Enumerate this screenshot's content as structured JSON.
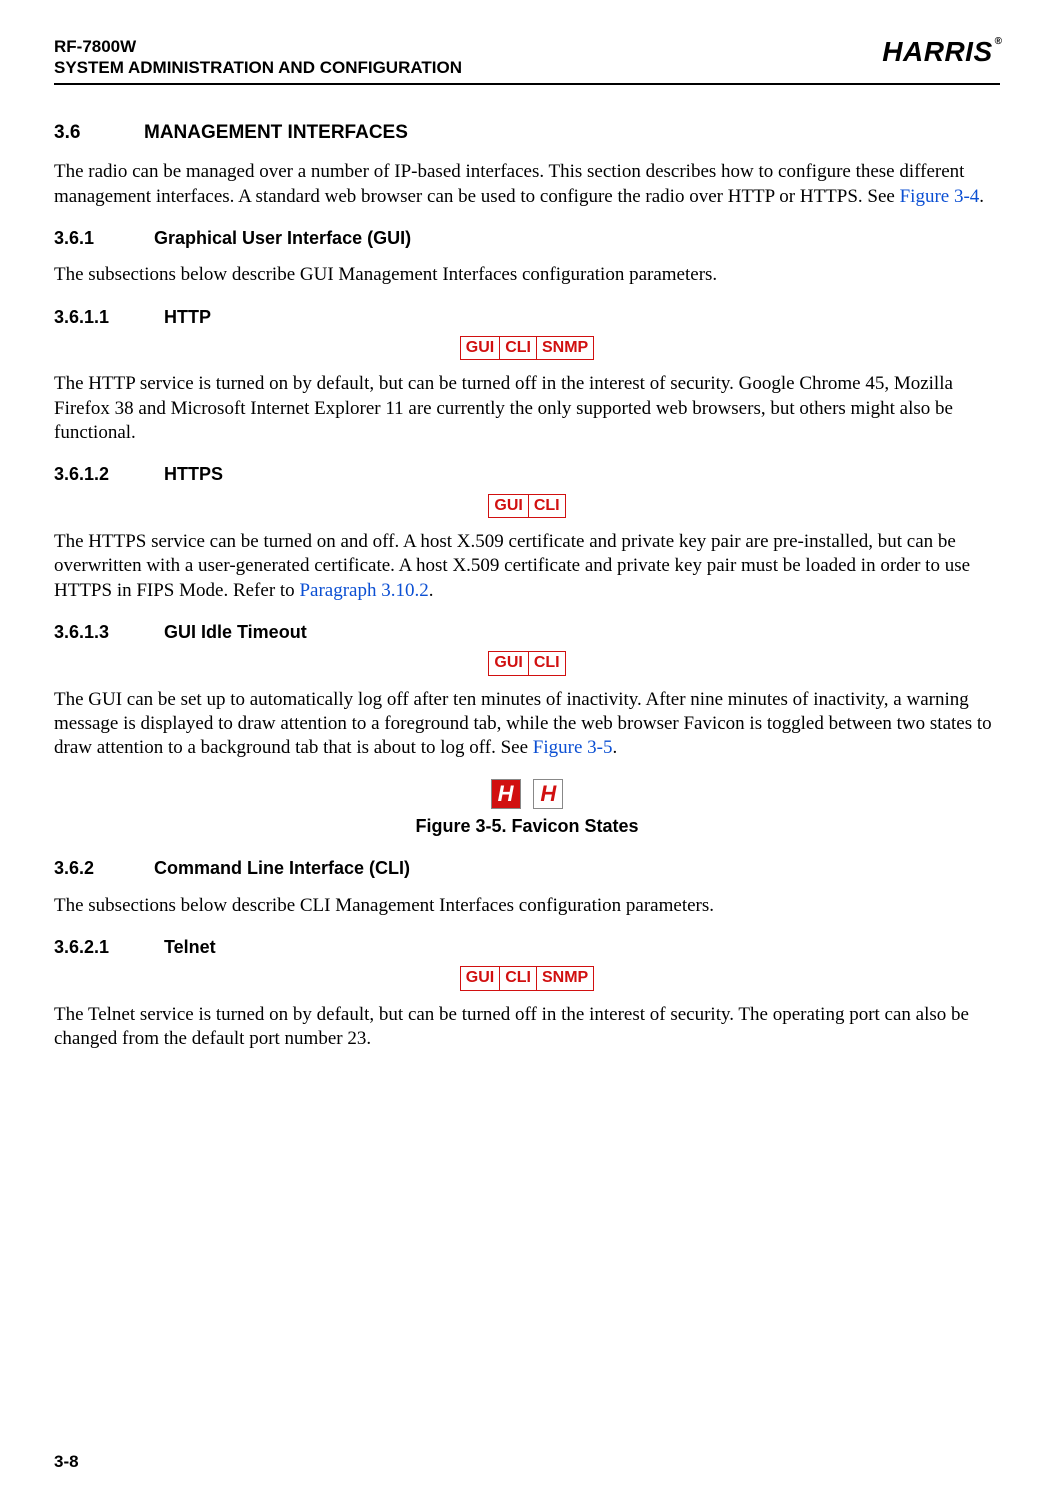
{
  "header": {
    "product": "RF-7800W",
    "subtitle": "SYSTEM ADMINISTRATION AND CONFIGURATION",
    "brand": "HARRIS",
    "reg": "®"
  },
  "page_number": "3-8",
  "sec_3_6": {
    "num": "3.6",
    "title": "MANAGEMENT INTERFACES",
    "para_pre": "The radio can be managed over a number of IP-based interfaces. This section describes how to configure these different management interfaces. A standard web browser can be used to configure the radio over HTTP or HTTPS. See ",
    "link": "Figure 3-4",
    "para_post": "."
  },
  "sec_3_6_1": {
    "num": "3.6.1",
    "title": "Graphical User Interface (GUI)",
    "para": "The subsections below describe GUI Management Interfaces configuration parameters."
  },
  "sec_3_6_1_1": {
    "num": "3.6.1.1",
    "title": "HTTP",
    "tags": {
      "gui": "GUI",
      "cli": "CLI",
      "snmp": "SNMP"
    },
    "para": "The HTTP service is turned on by default, but can be turned off in the interest of security. Google Chrome 45, Mozilla Firefox 38 and Microsoft Internet Explorer 11 are currently the only supported web browsers, but others might also be functional."
  },
  "sec_3_6_1_2": {
    "num": "3.6.1.2",
    "title": "HTTPS",
    "tags": {
      "gui": "GUI",
      "cli": "CLI"
    },
    "para_pre": "The HTTPS service can be turned on and off. A host X.509 certificate and private key pair are pre-installed, but can be overwritten with a user-generated certificate. A host X.509 certificate and private key pair must be loaded in order to use HTTPS in FIPS Mode. Refer to ",
    "link": "Paragraph 3.10.2",
    "para_post": "."
  },
  "sec_3_6_1_3": {
    "num": "3.6.1.3",
    "title": "GUI Idle Timeout",
    "tags": {
      "gui": "GUI",
      "cli": "CLI"
    },
    "para_pre": "The GUI can be set up to automatically log off after ten minutes of inactivity. After nine minutes of inactivity, a warning message is displayed to draw attention to a foreground tab, while the web browser Favicon is toggled between two states to draw attention to a background tab that is about to log off. See ",
    "link": "Figure 3-5",
    "para_post": "."
  },
  "figure_3_5": {
    "glyph": "H",
    "caption": "Figure 3-5.  Favicon States"
  },
  "sec_3_6_2": {
    "num": "3.6.2",
    "title": "Command Line Interface (CLI)",
    "para": "The subsections below describe CLI Management Interfaces configuration parameters."
  },
  "sec_3_6_2_1": {
    "num": "3.6.2.1",
    "title": "Telnet",
    "tags": {
      "gui": "GUI",
      "cli": "CLI",
      "snmp": "SNMP"
    },
    "para": "The Telnet service is turned on by default, but can be turned off in the interest of security. The operating port can also be changed from the default port number 23."
  }
}
